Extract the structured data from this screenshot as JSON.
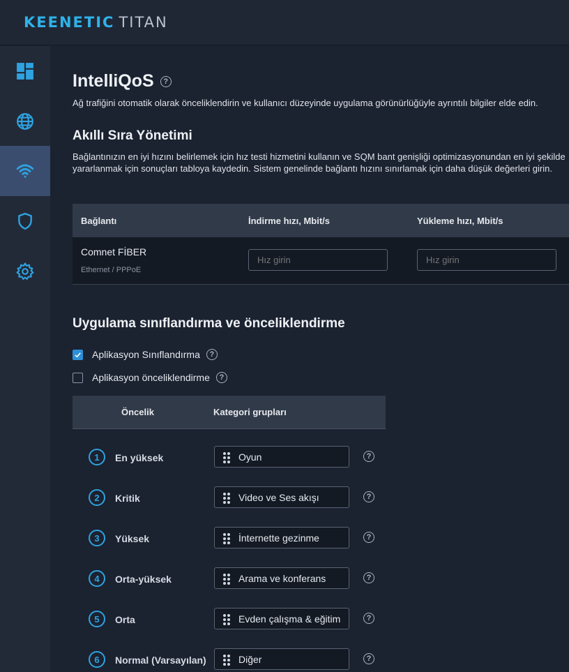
{
  "brand": {
    "name": "KEENETIC",
    "model": "TITAN"
  },
  "sidebar": {
    "items": [
      {
        "name": "dashboard"
      },
      {
        "name": "internet"
      },
      {
        "name": "wifi",
        "active": true
      },
      {
        "name": "security"
      },
      {
        "name": "settings"
      }
    ]
  },
  "page": {
    "title": "IntelliQoS",
    "subtitle": "Ağ trafiğini otomatik olarak önceliklendirin ve kullanıcı düzeyinde uygulama görünürlüğüyle ayrıntılı bilgiler elde edin."
  },
  "queue": {
    "title": "Akıllı Sıra Yönetimi",
    "description": "Bağlantınızın en iyi hızını belirlemek için hız testi hizmetini kullanın ve SQM bant genişliği optimizasyonundan en iyi şekilde yararlanmak için sonuçları tabloya kaydedin. Sistem genelinde bağlantı hızını sınırlamak için daha düşük değerleri girin.",
    "table": {
      "col_connection": "Bağlantı",
      "col_download": "İndirme hızı, Mbit/s",
      "col_upload": "Yükleme hızı, Mbit/s",
      "row": {
        "name": "Comnet FİBER",
        "type": "Ethernet / PPPoE",
        "download_placeholder": "Hız girin",
        "upload_placeholder": "Hız girin"
      }
    }
  },
  "classification": {
    "title": "Uygulama sınıflandırma ve önceliklendirme",
    "checkbox_classification": {
      "label": "Aplikasyon Sınıflandırma",
      "checked": true
    },
    "checkbox_prioritization": {
      "label": "Aplikasyon önceliklendirme",
      "checked": false
    },
    "table": {
      "col_priority": "Öncelik",
      "col_category": "Kategori grupları",
      "rows": [
        {
          "num": "1",
          "priority": "En yüksek",
          "category": "Oyun"
        },
        {
          "num": "2",
          "priority": "Kritik",
          "category": "Video ve Ses akışı"
        },
        {
          "num": "3",
          "priority": "Yüksek",
          "category": "İnternette gezinme"
        },
        {
          "num": "4",
          "priority": "Orta-yüksek",
          "category": "Arama ve konferans"
        },
        {
          "num": "5",
          "priority": "Orta",
          "category": "Evden çalışma & eğitim"
        },
        {
          "num": "6",
          "priority": "Normal (Varsayılan)",
          "category": "Diğer"
        }
      ]
    }
  },
  "colors": {
    "accent": "#2fa2e0",
    "active_nav": "#3a4d6e",
    "background": "#1b2230"
  }
}
